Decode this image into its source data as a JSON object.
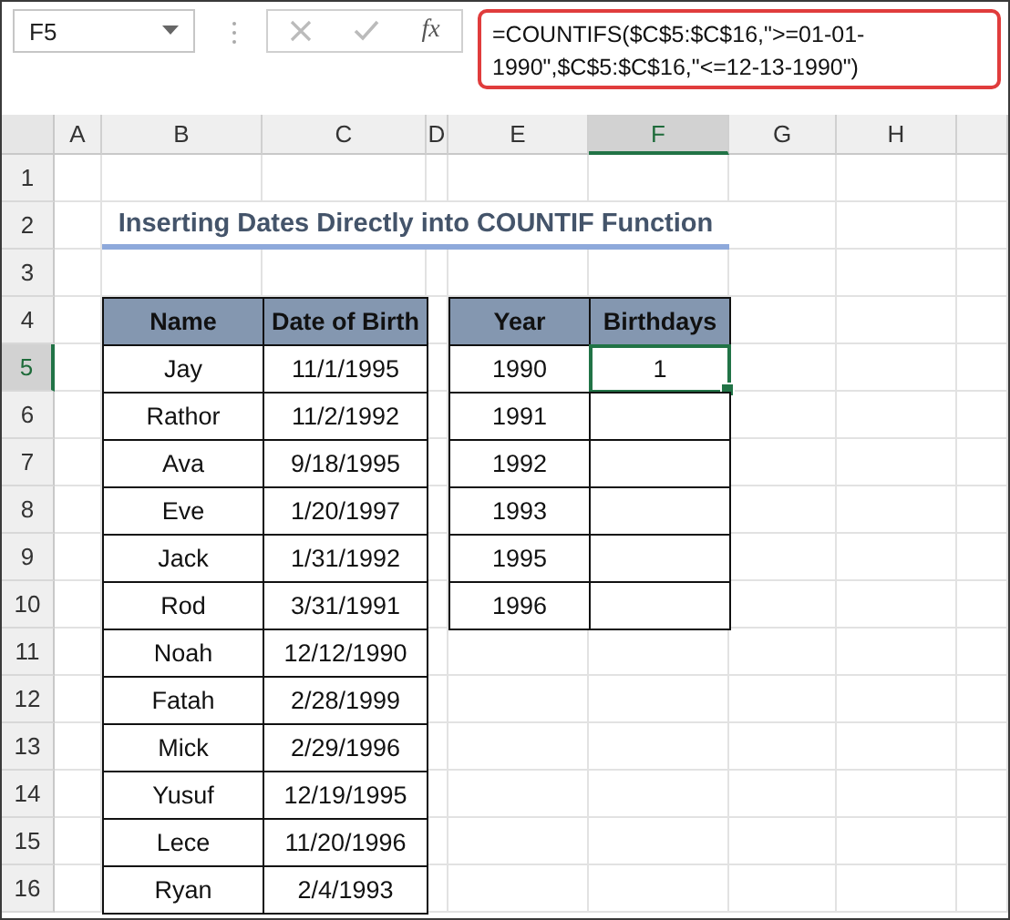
{
  "name_box": {
    "value": "F5"
  },
  "formula_bar": {
    "function_label": "fx",
    "formula": "=COUNTIFS($C$5:$C$16,\">=01-01-1990\",$C$5:$C$16,\"<=12-13-1990\")"
  },
  "columns": [
    {
      "label": "A",
      "selected": false
    },
    {
      "label": "B",
      "selected": false
    },
    {
      "label": "C",
      "selected": false
    },
    {
      "label": "D",
      "selected": false
    },
    {
      "label": "E",
      "selected": false
    },
    {
      "label": "F",
      "selected": true
    },
    {
      "label": "G",
      "selected": false
    },
    {
      "label": "H",
      "selected": false
    }
  ],
  "rows": [
    {
      "label": "1",
      "selected": false
    },
    {
      "label": "2",
      "selected": false
    },
    {
      "label": "3",
      "selected": false
    },
    {
      "label": "4",
      "selected": false
    },
    {
      "label": "5",
      "selected": true
    },
    {
      "label": "6",
      "selected": false
    },
    {
      "label": "7",
      "selected": false
    },
    {
      "label": "8",
      "selected": false
    },
    {
      "label": "9",
      "selected": false
    },
    {
      "label": "10",
      "selected": false
    },
    {
      "label": "11",
      "selected": false
    },
    {
      "label": "12",
      "selected": false
    },
    {
      "label": "13",
      "selected": false
    },
    {
      "label": "14",
      "selected": false
    },
    {
      "label": "15",
      "selected": false
    },
    {
      "label": "16",
      "selected": false
    }
  ],
  "title": "Inserting Dates Directly into COUNTIF Function",
  "people_table": {
    "columns": [
      "Name",
      "Date of Birth"
    ],
    "rows": [
      [
        "Jay",
        "11/1/1995"
      ],
      [
        "Rathor",
        "11/2/1992"
      ],
      [
        "Ava",
        "9/18/1995"
      ],
      [
        "Eve",
        "1/20/1997"
      ],
      [
        "Jack",
        "1/31/1992"
      ],
      [
        "Rod",
        "3/31/1991"
      ],
      [
        "Noah",
        "12/12/1990"
      ],
      [
        "Fatah",
        "2/28/1999"
      ],
      [
        "Mick",
        "2/29/1996"
      ],
      [
        "Yusuf",
        "12/19/1995"
      ],
      [
        "Lece",
        "11/20/1996"
      ],
      [
        "Ryan",
        "2/4/1993"
      ]
    ]
  },
  "birthday_table": {
    "columns": [
      "Year",
      "Birthdays"
    ],
    "rows": [
      {
        "year": "1990",
        "count": "1",
        "selected": true
      },
      {
        "year": "1991",
        "selected": false
      },
      {
        "year": "1992",
        "selected": false
      },
      {
        "year": "1993",
        "selected": false
      },
      {
        "year": "1995",
        "selected": false
      },
      {
        "year": "1996",
        "selected": false
      }
    ]
  }
}
